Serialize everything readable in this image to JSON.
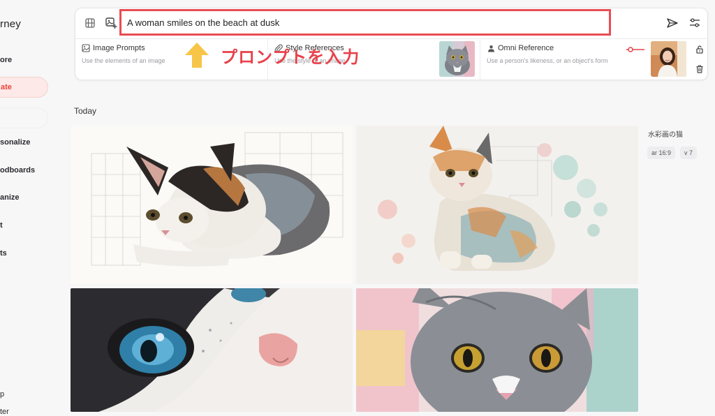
{
  "sidebar": {
    "brand": "rney",
    "items": [
      {
        "label": "ore",
        "active": false
      },
      {
        "label": "ate",
        "active": true
      },
      {
        "label": "sonalize",
        "active": false
      },
      {
        "label": "odboards",
        "active": false
      },
      {
        "label": "anize",
        "active": false
      },
      {
        "label": "t",
        "active": false
      },
      {
        "label": "ts",
        "active": false
      }
    ],
    "bottom_items": [
      "p",
      "ter"
    ]
  },
  "prompt": {
    "value": "A woman smiles on the beach at dusk",
    "placeholder": ""
  },
  "sections": {
    "image_prompts": {
      "title": "Image Prompts",
      "subtitle": "Use the elements of an image"
    },
    "style_references": {
      "title": "Style References",
      "subtitle": "Use the style of an image"
    },
    "omni_reference": {
      "title": "Omni Reference",
      "subtitle": "Use a person's likeness, or an object's form"
    }
  },
  "annotation": {
    "text": "プロンプトを入力",
    "color": "#e8414b"
  },
  "feed": {
    "heading": "Today",
    "group_title": "水彩画の猫",
    "params": [
      "ar 16:9",
      "v 7"
    ]
  },
  "icons": {
    "frames": "film-frame-icon",
    "add_image": "add-image-icon",
    "send": "send-icon",
    "settings": "sliders-icon",
    "image": "image-icon",
    "style": "paperclip-icon",
    "person": "person-icon",
    "lock": "unlock-icon",
    "delete": "trash-icon"
  },
  "colors": {
    "accent": "#e8443a",
    "highlight_box": "#e84c52",
    "arrow": "#f7c548"
  }
}
